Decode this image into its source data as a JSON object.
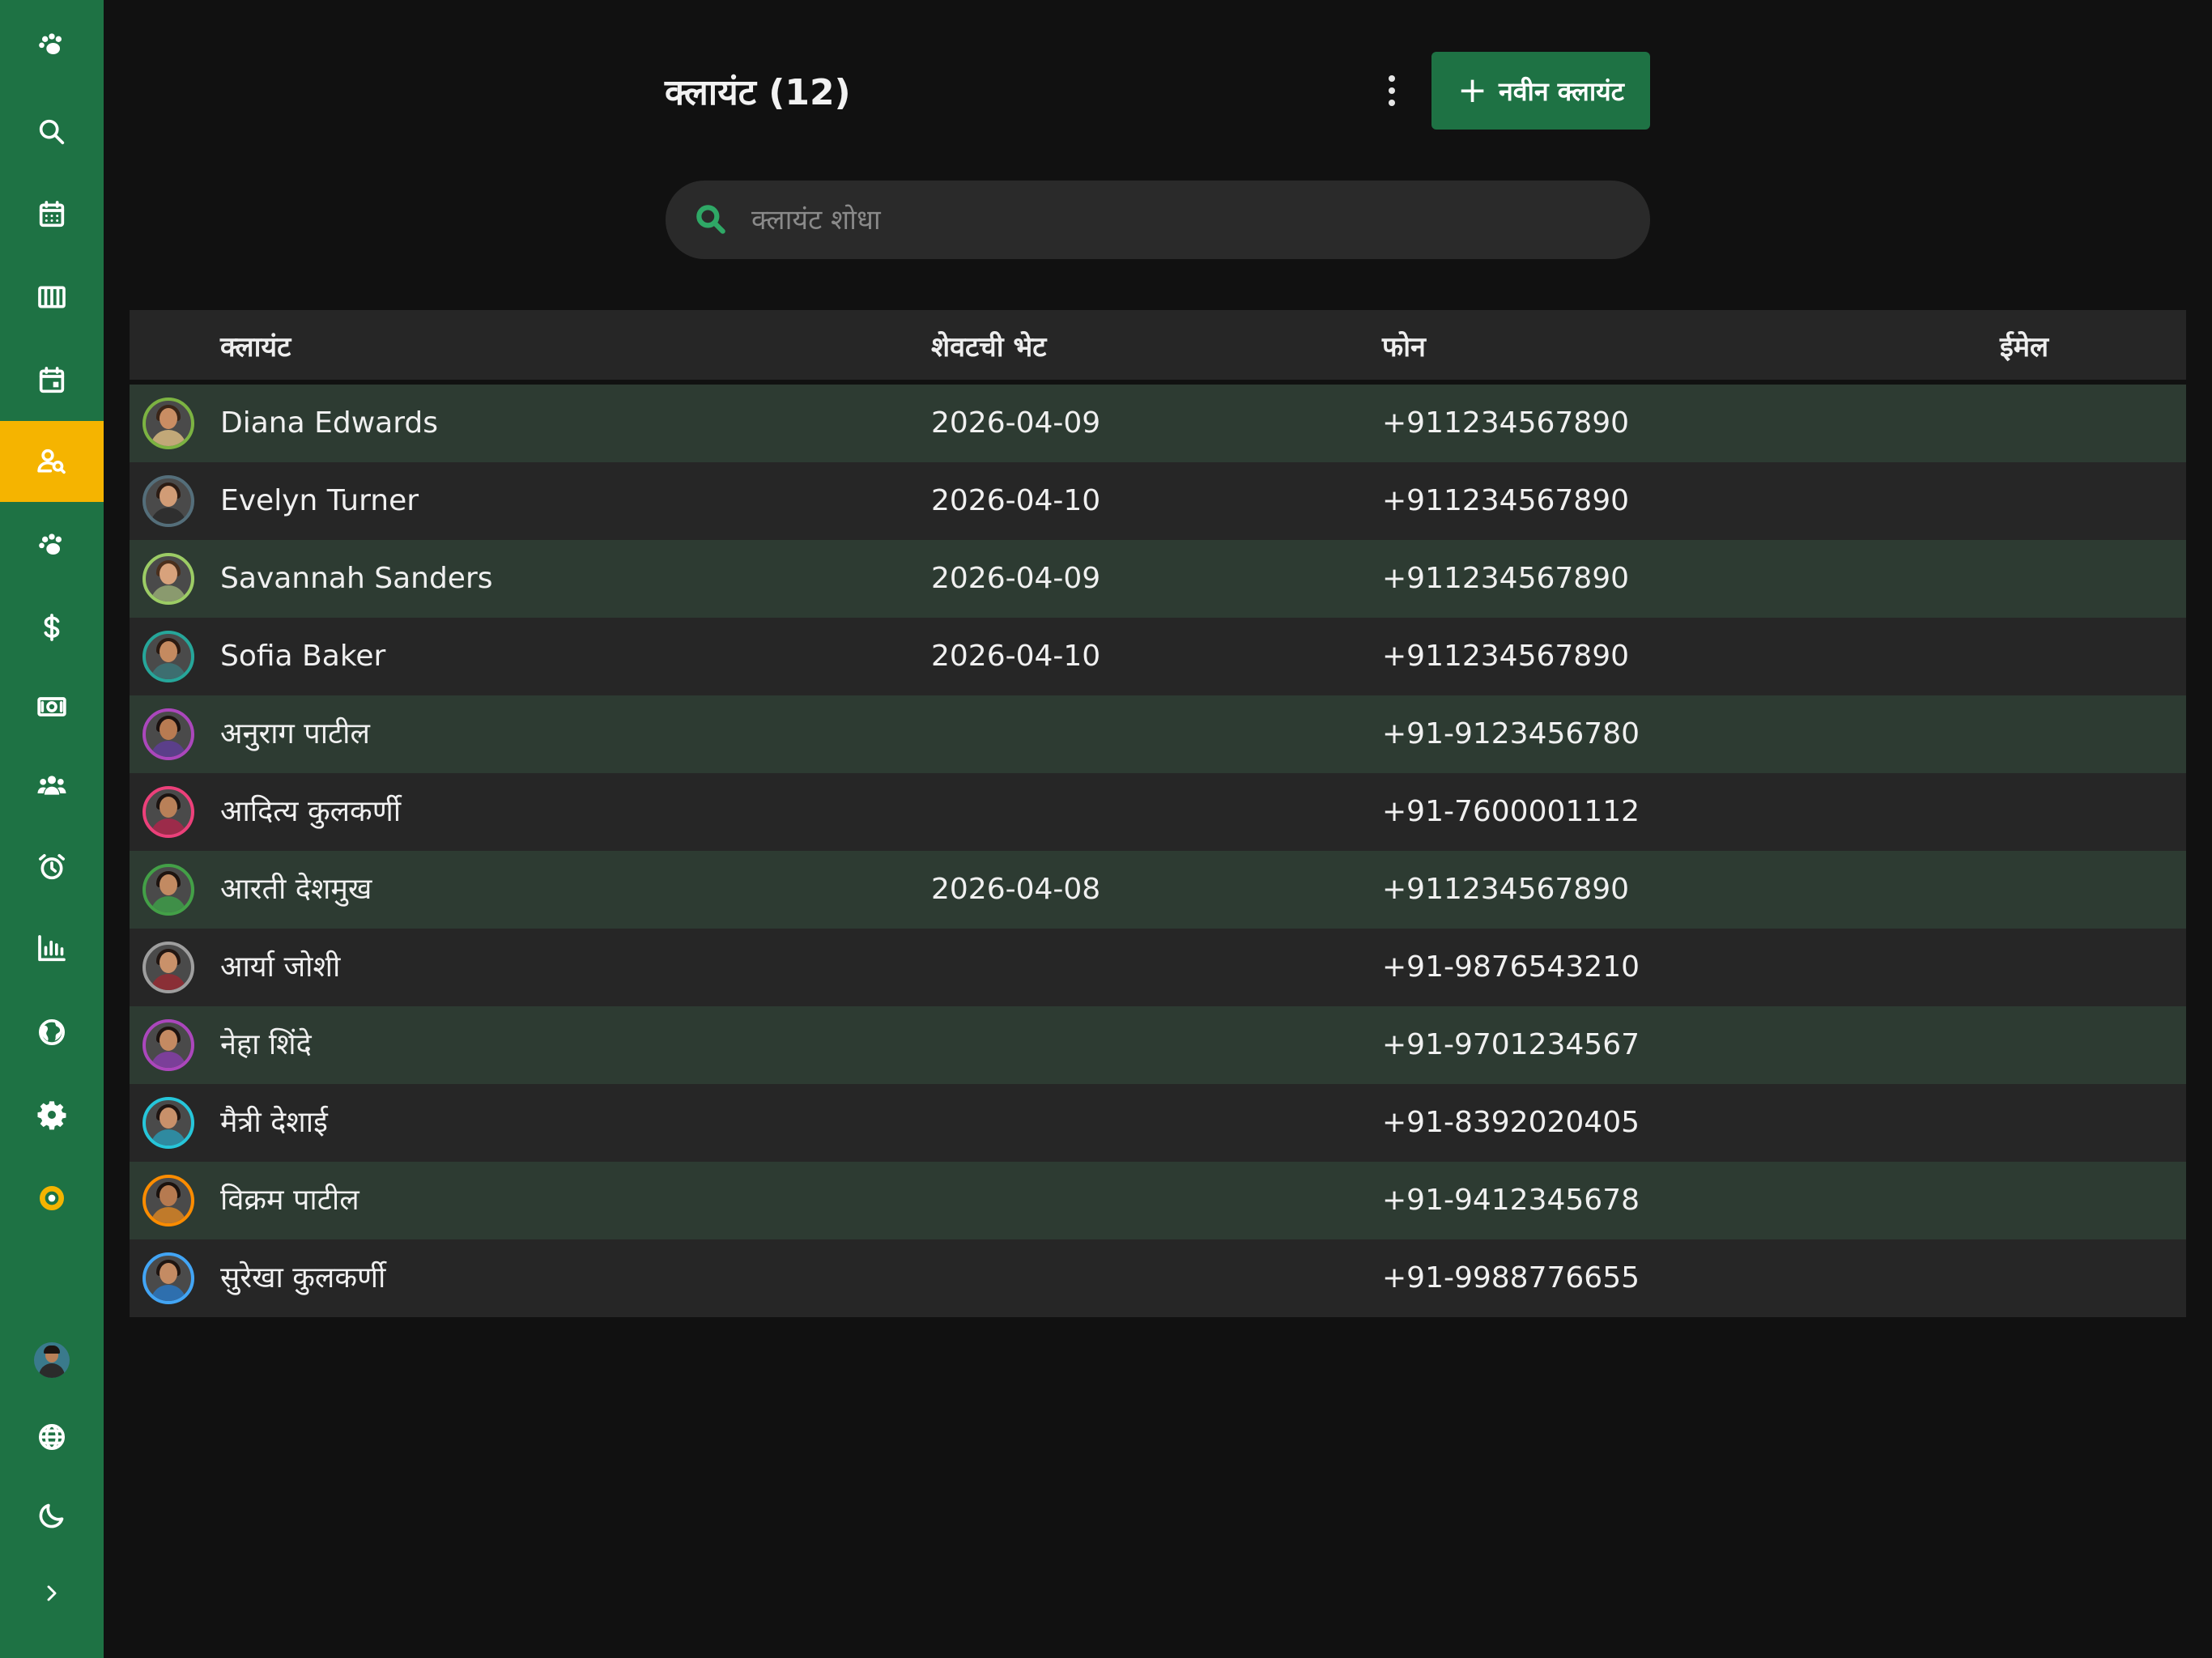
{
  "sidebar": {
    "items": [
      {
        "name": "paw-icon",
        "active": false
      },
      {
        "name": "search-icon",
        "active": false
      },
      {
        "name": "calendar-icon",
        "active": false
      },
      {
        "name": "columns-icon",
        "active": false
      },
      {
        "name": "calendar-day-icon",
        "active": false
      },
      {
        "name": "client-search-icon",
        "active": true
      },
      {
        "name": "paw-icon",
        "active": false
      },
      {
        "name": "dollar-icon",
        "active": false
      },
      {
        "name": "cash-icon",
        "active": false
      },
      {
        "name": "users-icon",
        "active": false
      },
      {
        "name": "alarm-icon",
        "active": false
      },
      {
        "name": "bar-chart-icon",
        "active": false
      },
      {
        "name": "globe-icon",
        "active": false
      },
      {
        "name": "gear-icon",
        "active": false
      },
      {
        "name": "ring-icon",
        "active": false
      }
    ],
    "bottom": [
      "avatar",
      "language-globe-icon",
      "moon-icon",
      "chevron-right-icon"
    ],
    "accent": "#1e7244",
    "active_color": "#f5b400"
  },
  "header": {
    "title": "क्लायंट (12)",
    "new_button_label": "नवीन क्लायंट",
    "new_button_icon": "plus-icon"
  },
  "search": {
    "placeholder": "क्लायंट शोधा",
    "value": ""
  },
  "table": {
    "columns": [
      "क्लायंट",
      "शेवटची भेट",
      "फोन",
      "ईमेल"
    ],
    "rows": [
      {
        "name": "Diana Edwards",
        "last_visit": "2026-04-09",
        "phone": "+911234567890",
        "email": "",
        "ring": "#7cb342",
        "skin": "#c98d63",
        "hair": "#3a2518",
        "shirt": "#c2a878"
      },
      {
        "name": "Evelyn Turner",
        "last_visit": "2026-04-10",
        "phone": "+911234567890",
        "email": "",
        "ring": "#546e7a",
        "skin": "#d19c76",
        "hair": "#2c1c14",
        "shirt": "#2f2f2f"
      },
      {
        "name": "Savannah Sanders",
        "last_visit": "2026-04-09",
        "phone": "+911234567890",
        "email": "",
        "ring": "#9ccc65",
        "skin": "#d8a27c",
        "hair": "#4a2f1d",
        "shirt": "#8a9a6e"
      },
      {
        "name": "Sofia Baker",
        "last_visit": "2026-04-10",
        "phone": "+911234567890",
        "email": "",
        "ring": "#26a69a",
        "skin": "#c48a60",
        "hair": "#2a1a12",
        "shirt": "#3d6e70"
      },
      {
        "name": "अनुराग पाटील",
        "last_visit": "",
        "phone": "+91-9123456780",
        "email": "",
        "ring": "#ab47bc",
        "skin": "#b87b52",
        "hair": "#1b1210",
        "shirt": "#5b3f8a"
      },
      {
        "name": "आदित्य कुलकर्णी",
        "last_visit": "",
        "phone": "+91-7600001112",
        "email": "",
        "ring": "#ec407a",
        "skin": "#b98058",
        "hair": "#1c1411",
        "shirt": "#9c2b4a"
      },
      {
        "name": "आरती देशमुख",
        "last_visit": "2026-04-08",
        "phone": "+911234567890",
        "email": "",
        "ring": "#43a047",
        "skin": "#c28a62",
        "hair": "#1e1410",
        "shirt": "#3f8f48"
      },
      {
        "name": "आर्या जोशी",
        "last_visit": "",
        "phone": "+91-9876543210",
        "email": "",
        "ring": "#9e9e9e",
        "skin": "#c9916a",
        "hair": "#221612",
        "shirt": "#8a2f36"
      },
      {
        "name": "नेहा शिंदे",
        "last_visit": "",
        "phone": "+91-9701234567",
        "email": "",
        "ring": "#ab47bc",
        "skin": "#c48a62",
        "hair": "#1d1310",
        "shirt": "#7b3f99"
      },
      {
        "name": "मैत्री देशाई",
        "last_visit": "",
        "phone": "+91-8392020405",
        "email": "",
        "ring": "#26c6da",
        "skin": "#c8906a",
        "hair": "#201512",
        "shirt": "#2f8aa0"
      },
      {
        "name": "विक्रम पाटील",
        "last_visit": "",
        "phone": "+91-9412345678",
        "email": "",
        "ring": "#fb8c00",
        "skin": "#b67a50",
        "hair": "#1a120e",
        "shirt": "#c07a2a"
      },
      {
        "name": "सुरेखा कुलकर्णी",
        "last_visit": "",
        "phone": "+91-9988776655",
        "email": "",
        "ring": "#42a5f5",
        "skin": "#c48b63",
        "hair": "#1f1511",
        "shirt": "#2e6fae"
      }
    ]
  },
  "colors": {
    "background": "#111111",
    "row_alt": "#2d3b32",
    "row_plain": "#262626",
    "search_icon": "#2fa866"
  }
}
